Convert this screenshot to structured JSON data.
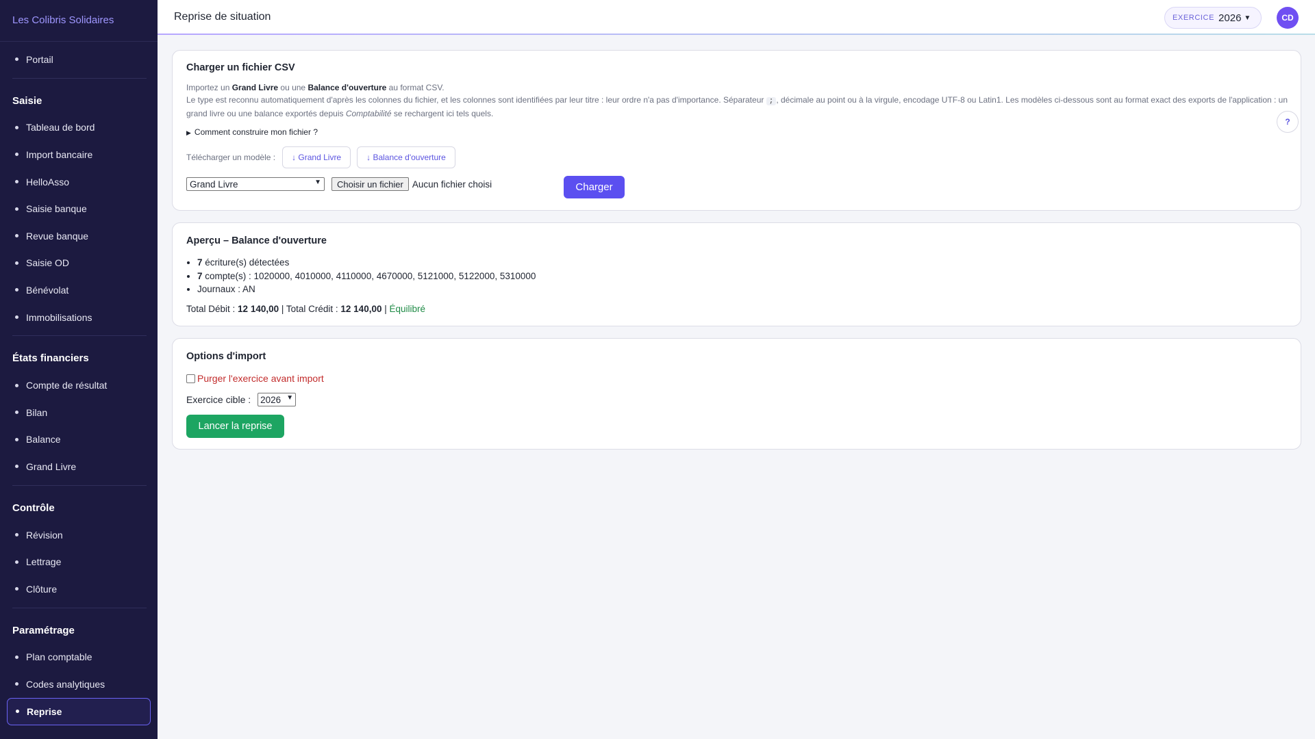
{
  "brand": "Les Colibris Solidaires",
  "sidebar": {
    "top_item": "Portail",
    "sections": [
      {
        "title": "Saisie",
        "items": [
          "Tableau de bord",
          "Import bancaire",
          "HelloAsso",
          "Saisie banque",
          "Revue banque",
          "Saisie OD",
          "Bénévolat",
          "Immobilisations"
        ]
      },
      {
        "title": "États financiers",
        "items": [
          "Compte de résultat",
          "Bilan",
          "Balance",
          "Grand Livre"
        ]
      },
      {
        "title": "Contrôle",
        "items": [
          "Révision",
          "Lettrage",
          "Clôture"
        ]
      },
      {
        "title": "Paramétrage",
        "items": [
          "Plan comptable",
          "Codes analytiques"
        ]
      }
    ],
    "active_item": "Reprise"
  },
  "header": {
    "title": "Reprise de situation",
    "exercice_label": "EXERCICE",
    "exercice_year": "2026",
    "avatar_initials": "CD"
  },
  "upload": {
    "title": "Charger un fichier CSV",
    "desc1_pre": "Importez un ",
    "desc1_b1": "Grand Livre",
    "desc1_mid": " ou une ",
    "desc1_b2": "Balance d'ouverture",
    "desc1_post": " au format CSV.",
    "desc2_pre": "Le type est reconnu automatiquement d'après les colonnes du fichier, et les colonnes sont identifiées par leur titre : leur ordre n'a pas d'importance. Séparateur ",
    "separator": ";",
    "desc2_post": ", décimale au point ou à la virgule, encodage UTF-8 ou Latin1. Les modèles ci-dessous sont au format exact des exports de l'application : un grand livre ou une balance exportés depuis ",
    "desc2_em": "Comptabilité",
    "desc2_end": " se rechargent ici tels quels.",
    "help_label": "?",
    "details_label": "Comment construire mon fichier ?",
    "download_label": "Télécharger un modèle :",
    "download_gl": "↓ Grand Livre",
    "download_bo": "↓ Balance d'ouverture",
    "type_selected": "Grand Livre",
    "file_button": "Choisir un fichier",
    "file_status": "Aucun fichier choisi",
    "submit": "Charger"
  },
  "preview": {
    "title": "Aperçu – Balance d'ouverture",
    "entries_count": "7",
    "entries_text": " écriture(s) détectées",
    "accounts_count": "7",
    "accounts_text": " compte(s) : 1020000, 4010000, 4110000, 4670000, 5121000, 5122000, 5310000",
    "journaux": "Journaux : AN",
    "total_debit_label": "Total Débit : ",
    "total_debit": "12 140,00",
    "total_credit_label": " | Total Crédit : ",
    "total_credit": "12 140,00",
    "sep": " | ",
    "status": "Équilibré"
  },
  "options": {
    "title": "Options d'import",
    "purge_label": "Purger l'exercice avant import",
    "target_label": "Exercice cible :",
    "target_year": "2026",
    "launch": "Lancer la reprise"
  }
}
